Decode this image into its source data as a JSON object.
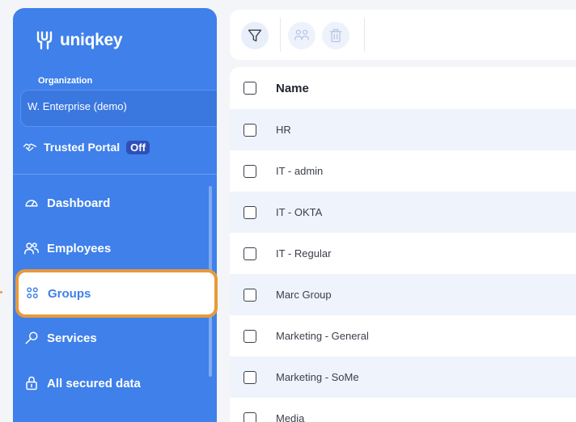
{
  "app": {
    "logo_text": "uniqkey"
  },
  "organization": {
    "label": "Organization",
    "selected": "W. Enterprise (demo)"
  },
  "trusted_portal": {
    "label": "Trusted Portal",
    "status": "Off"
  },
  "nav": {
    "dashboard": "Dashboard",
    "employees": "Employees",
    "groups": "Groups",
    "services": "Services",
    "all_secured_data": "All secured data"
  },
  "toolbar": {
    "icons": [
      "filter-icon",
      "group-users-icon",
      "trash-icon"
    ]
  },
  "table": {
    "header": "Name",
    "rows": [
      "HR",
      "IT - admin",
      "IT - OKTA",
      "IT - Regular",
      "Marc Group",
      "Marketing - General",
      "Marketing - SoMe",
      "Media"
    ]
  },
  "colors": {
    "sidebar": "#3f80ea",
    "highlight": "#e79a3a",
    "row_alt": "#eef3fc"
  }
}
